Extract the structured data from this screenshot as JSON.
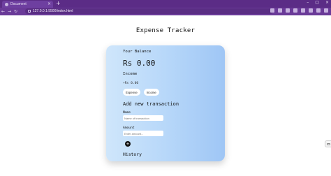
{
  "browser": {
    "tab_title": "Document",
    "tab_close": "×",
    "new_tab": "+",
    "window_controls": [
      "–",
      "▢",
      "×"
    ],
    "nav": [
      "←",
      "→",
      "↻"
    ],
    "url": "127.0.0.1:5500/index.html",
    "toolbar_icons": [
      "share-icon",
      "bookmark-star-icon",
      "extension-icon",
      "puzzle-icon",
      "downloads-icon",
      "sidebar-icon",
      "profile-icon",
      "menu-icon"
    ]
  },
  "page": {
    "title": "Expense Tracker"
  },
  "card": {
    "balance_label": "Your Balance",
    "balance_value": "Rs 0.00",
    "income_label": "Income",
    "income_value": "+Rs 0.00",
    "pills": [
      "Expense",
      "Income"
    ],
    "add_heading": "Add new transaction",
    "name_label": "Name",
    "name_placeholder": "Name of transaction",
    "amount_label": "Amount",
    "amount_placeholder": "Enter amount...",
    "add_button": "+",
    "history_heading": "History"
  },
  "colors": {
    "tabbar": "#5b2c86",
    "toolbar": "#6a3a98",
    "card_gradient_start": "#cfe6fb",
    "card_gradient_end": "#9fc6f5"
  }
}
